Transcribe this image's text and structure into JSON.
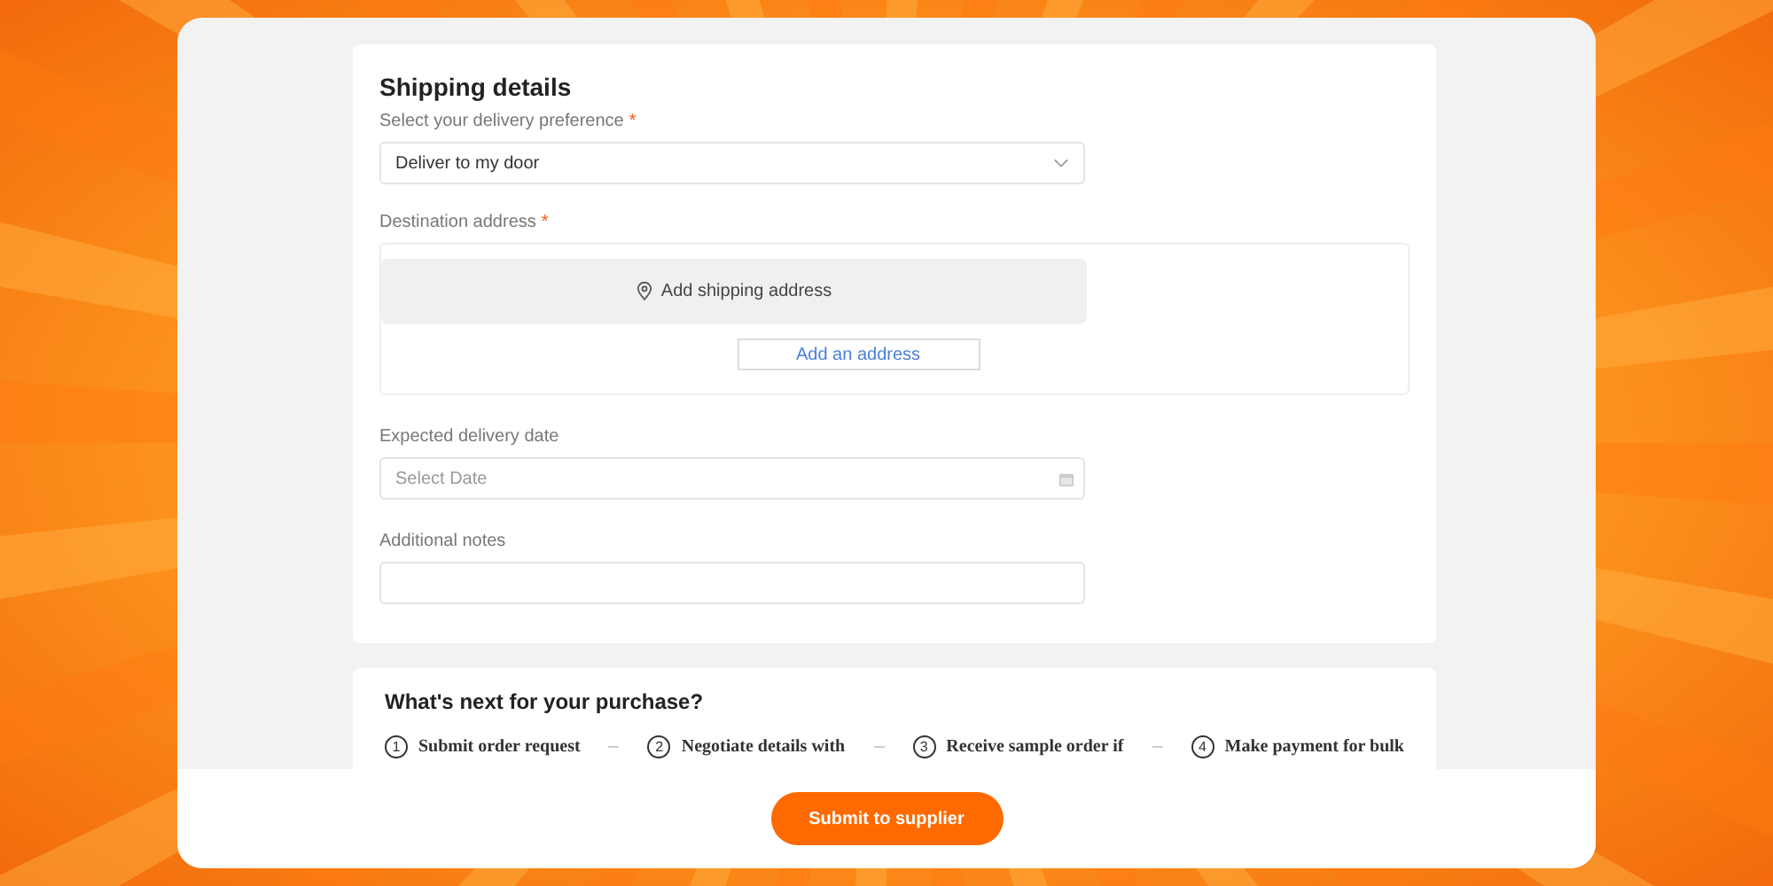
{
  "shipping": {
    "title": "Shipping details",
    "delivery": {
      "label": "Select your delivery preference",
      "required_mark": "*",
      "value": "Deliver to my door"
    },
    "address": {
      "label": "Destination address",
      "required_mark": "*",
      "prompt": "Add shipping address",
      "button": "Add an address"
    },
    "date": {
      "label": "Expected delivery date",
      "placeholder": "Select Date"
    },
    "notes": {
      "label": "Additional notes"
    }
  },
  "next": {
    "title": "What's next for your purchase?",
    "steps": [
      {
        "number": "1",
        "text": "Submit order request"
      },
      {
        "number": "2",
        "text": "Negotiate details with"
      },
      {
        "number": "3",
        "text": "Receive sample order if"
      },
      {
        "number": "4",
        "text": "Make payment for bulk"
      }
    ]
  },
  "footer": {
    "button": "Submit to supplier"
  }
}
